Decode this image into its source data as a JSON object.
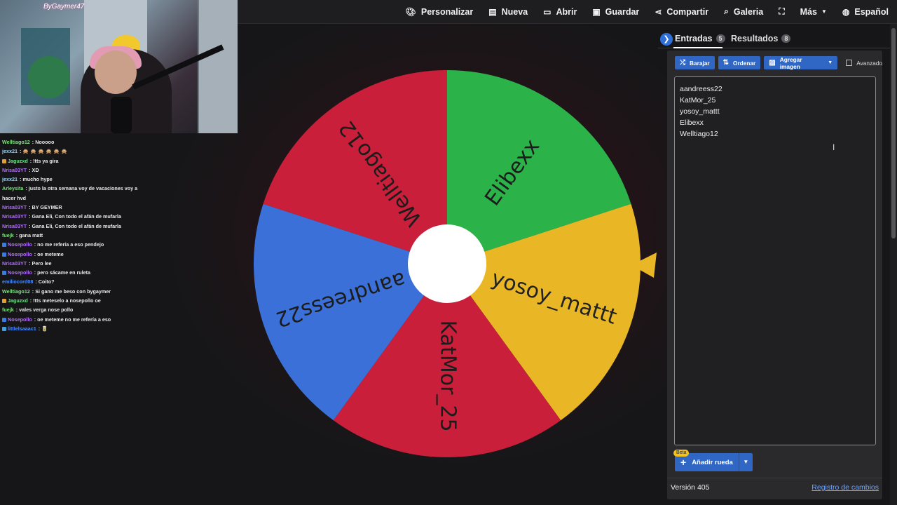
{
  "webcam": {
    "logo_text": "ByGaymer47"
  },
  "chat": [
    {
      "user": "Welltiago12",
      "color": "#7fe07f",
      "text": ": Nooooo"
    },
    {
      "user": "jexx21",
      "color": "#8fd8ff",
      "text": ": 🙊 🙊 🙊 🙊 🙊 🙊"
    },
    {
      "user": "Jaguzxd",
      "color": "#6fe38a",
      "badge": "#e0a030",
      "text": ": !tts ya gira"
    },
    {
      "user": "Nrisa03YT",
      "color": "#b36cff",
      "text": ": XD"
    },
    {
      "user": "jexx21",
      "color": "#8fd8ff",
      "text": ": mucho hype"
    },
    {
      "user": "Arleysita",
      "color": "#7fe07f",
      "text": ": justo la otra semana voy de vacaciones voy a hacer hvd"
    },
    {
      "user": "Nrisa03YT",
      "color": "#b36cff",
      "text": ": BY GEYMER"
    },
    {
      "user": "Nrisa03YT",
      "color": "#b36cff",
      "text": ": Gana Eli, Con todo el afán de mufarla"
    },
    {
      "user": "Nrisa03YT",
      "color": "#b36cff",
      "text": ": Gana Eli, Con todo el afán de mufarla"
    },
    {
      "user": "fuejk",
      "color": "#7fe07f",
      "text": ": gana matt"
    },
    {
      "user": "Nosepollo",
      "color": "#b36cff",
      "badge": "#3a7be0",
      "text": ": no me refería a eso pendejo"
    },
    {
      "user": "Nosepollo",
      "color": "#b36cff",
      "badge": "#3a7be0",
      "text": ": oe meteme"
    },
    {
      "user": "Nrisa03YT",
      "color": "#b36cff",
      "text": ": Pero lee"
    },
    {
      "user": "Nosepollo",
      "color": "#b36cff",
      "badge": "#3a7be0",
      "text": ": pero sácame en ruleta"
    },
    {
      "user": "emiliocord08",
      "color": "#4a8cff",
      "text": ": Coito?"
    },
    {
      "user": "Welltiago12",
      "color": "#7fe07f",
      "text": ": Si gano me beso con bygaymer"
    },
    {
      "user": "Jaguzxd",
      "color": "#6fe38a",
      "badge": "#e0a030",
      "text": ": !tts meteselo a nosepollo oe"
    },
    {
      "user": "fuejk",
      "color": "#7fe07f",
      "text": ": vales verga nose pollo"
    },
    {
      "user": "Nosepollo",
      "color": "#b36cff",
      "badge": "#3a7be0",
      "text": ": oe meteme no me refería a eso"
    },
    {
      "user": "littlelsaaac1",
      "color": "#4a8cff",
      "badge": "#3aa0e0",
      "text": ": 🥫"
    }
  ],
  "topbar": {
    "personalize": "Personalizar",
    "new": "Nueva",
    "open": "Abrir",
    "save": "Guardar",
    "share": "Compartir",
    "gallery": "Galeria",
    "more": "Más",
    "language": "Español"
  },
  "wheel": {
    "segments": [
      {
        "label": "Elibexx",
        "color": "#2bb34a"
      },
      {
        "label": "yosoy_mattt",
        "color": "#e9b726"
      },
      {
        "label": "KatMor_25",
        "color": "#c91f3a"
      },
      {
        "label": "aandreess22",
        "color": "#3b70d8"
      },
      {
        "label": "Welltiago12",
        "color": "#c91f3a"
      }
    ],
    "pointer_color": "#e9b726"
  },
  "panel": {
    "tab_entries": "Entradas",
    "entries_count": "5",
    "tab_results": "Resultados",
    "results_count": "8",
    "shuffle": "Barajar",
    "sort": "Ordenar",
    "add_image": "Agregar imagen",
    "advanced": "Avanzado",
    "entries": [
      "aandreess22",
      "KatMor_25",
      "yosoy_mattt",
      "Elibexx",
      "Welltiago12"
    ],
    "beta": "Beta",
    "add_wheel": "Añadir rueda",
    "version": "Versión 405",
    "changelog": "Registro de cambios"
  }
}
